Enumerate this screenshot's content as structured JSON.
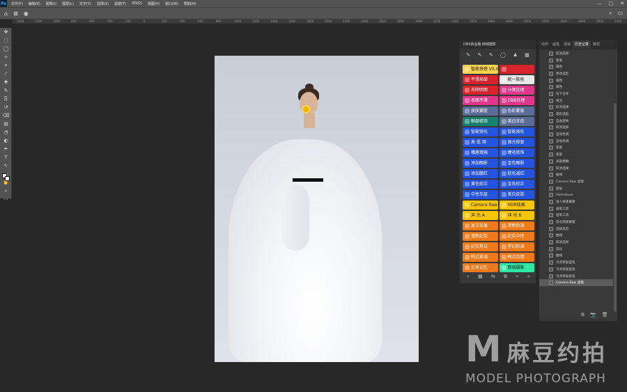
{
  "app": {
    "logo": "Ps"
  },
  "menu": [
    "文件(F)",
    "编辑(E)",
    "图像(I)",
    "图层(L)",
    "文字(Y)",
    "选择(S)",
    "滤镜(T)",
    "3D(D)",
    "视图(V)",
    "窗口(W)",
    "帮助(H)"
  ],
  "window_controls": {
    "minimize": "—",
    "maximize": "□",
    "close": "✕"
  },
  "options_bar": {
    "home_icon": "⌂",
    "artboard_icon": "⊠",
    "search_icon": "⌕",
    "workspace_icon": "▭"
  },
  "ruler_ticks": [
    "1400",
    "1200",
    "1000",
    "800",
    "600",
    "400",
    "200",
    "0",
    "200",
    "400",
    "600",
    "800",
    "1000",
    "1200",
    "1400",
    "1600",
    "1800",
    "2000",
    "2200",
    "2400",
    "2600",
    "2800",
    "3000",
    "3200",
    "3400",
    "3600",
    "3800",
    "4000",
    "4200",
    "4400",
    "4600",
    "4800",
    "5000",
    "5200"
  ],
  "toolbar_icons": [
    "move-icon",
    "marquee-icon",
    "lasso-icon",
    "quick-select-icon",
    "crop-icon",
    "eyedropper-icon",
    "spot-heal-icon",
    "brush-icon",
    "stamp-icon",
    "history-brush-icon",
    "eraser-icon",
    "gradient-icon",
    "blur-icon",
    "dodge-icon",
    "pen-icon",
    "type-icon",
    "path-select-icon",
    "shape-icon",
    "hand-icon",
    "zoom-icon",
    "more-icon"
  ],
  "dbs_panel": {
    "title": "DBS商业版·西城摄影",
    "top_icons": [
      "✎",
      "✎",
      "✎",
      "◯",
      "♟",
      "▦"
    ],
    "rows": [
      [
        {
          "label": "智能快修 V5.0",
          "color": "c-gold"
        },
        {
          "label": "",
          "color": "c-red"
        }
      ],
      [
        {
          "label": "平滑局部",
          "color": "c-red"
        },
        {
          "label": "统一肤色",
          "color": "c-white"
        }
      ],
      [
        {
          "label": "去除明瑕",
          "color": "c-red"
        },
        {
          "label": "分频处理",
          "color": "c-pink"
        }
      ],
      [
        {
          "label": "表面平滑",
          "color": "c-pink"
        },
        {
          "label": "DBB处理",
          "color": "c-pink"
        }
      ],
      [
        {
          "label": "皮肤蒙版",
          "color": "c-slate"
        },
        {
          "label": "色彩蒙版",
          "color": "c-slate"
        }
      ],
      [
        {
          "label": "眼部修饰",
          "color": "c-teal"
        },
        {
          "label": "美白牙齿",
          "color": "c-slate"
        }
      ],
      [
        {
          "label": "智能锐化",
          "color": "c-blue"
        },
        {
          "label": "智能液化",
          "color": "c-blue"
        }
      ],
      [
        {
          "label": "高 低 频",
          "color": "c-blue"
        },
        {
          "label": "高光修复",
          "color": "c-blue"
        }
      ],
      [
        {
          "label": "嘴唇增强",
          "color": "c-blue"
        },
        {
          "label": "睫毛修饰",
          "color": "c-blue"
        }
      ],
      [
        {
          "label": "添加眼影",
          "color": "c-blue"
        },
        {
          "label": "金色眼影",
          "color": "c-blue"
        }
      ],
      [
        {
          "label": "添加腮红",
          "color": "c-blue"
        },
        {
          "label": "肤色减红",
          "color": "c-blue"
        }
      ],
      [
        {
          "label": "黄色校正",
          "color": "c-blue"
        },
        {
          "label": "金色校正",
          "color": "c-blue"
        }
      ],
      [
        {
          "label": "中性灰层",
          "color": "c-blue"
        },
        {
          "label": "美白皮肤",
          "color": "c-blue"
        }
      ],
      [
        {
          "label": "Camera Raw",
          "color": "c-yellow"
        },
        {
          "label": "HDR效果",
          "color": "c-yellow"
        }
      ],
      [
        {
          "label": "冲 光 A",
          "color": "c-yellow"
        },
        {
          "label": "冲 光 B",
          "color": "c-yellow"
        }
      ],
      [
        {
          "label": "复古效果",
          "color": "c-orange"
        },
        {
          "label": "清新粉调",
          "color": "c-orange"
        }
      ],
      [
        {
          "label": "清新纪实",
          "color": "c-orange"
        },
        {
          "label": "纪实中性",
          "color": "c-orange"
        }
      ],
      [
        {
          "label": "纪实黑白",
          "color": "c-orange"
        },
        {
          "label": "梦幻粉调",
          "color": "c-orange"
        }
      ],
      [
        {
          "label": "韩式柔调",
          "color": "c-orange"
        },
        {
          "label": "韩式风情",
          "color": "c-orange"
        }
      ],
      [
        {
          "label": "日系记忆",
          "color": "c-orange"
        },
        {
          "label": "西城摄影",
          "color": "c-lime"
        }
      ]
    ],
    "footer_icons": [
      "⌕",
      "▦",
      "⇆",
      "⧉",
      "«",
      "»"
    ]
  },
  "history_panel": {
    "tabs": [
      "动作",
      "画笔",
      "通道",
      "历史记录",
      "路径"
    ],
    "active_tab": 3,
    "items": [
      "取消选择",
      "套索",
      "属性",
      "移动选区",
      "属性",
      "属性",
      "向下合并",
      "填充",
      "取消选择",
      "矩形选框",
      "自由变换",
      "取消选择",
      "自动色调",
      "自动色调",
      "套索",
      "套索",
      "高斯模糊",
      "取消选择",
      "曲线",
      "Camera Raw 滤镜",
      "图层",
      "Portraiture",
      "进入快速蒙版",
      "画笔工具",
      "画笔工具",
      "退出快速蒙版",
      "选择反向",
      "曲线",
      "取消选择",
      "液化",
      "曲线",
      "污点修复画笔",
      "污点修复画笔",
      "污点修复画笔",
      "Camera Raw 滤镜"
    ],
    "active_index": 34,
    "footer_icons": [
      "⧉",
      "📷",
      "🗑"
    ]
  },
  "watermark": {
    "letter": "M",
    "cn": "麻豆约拍",
    "en": "MODEL PHOTOGRAPH"
  }
}
